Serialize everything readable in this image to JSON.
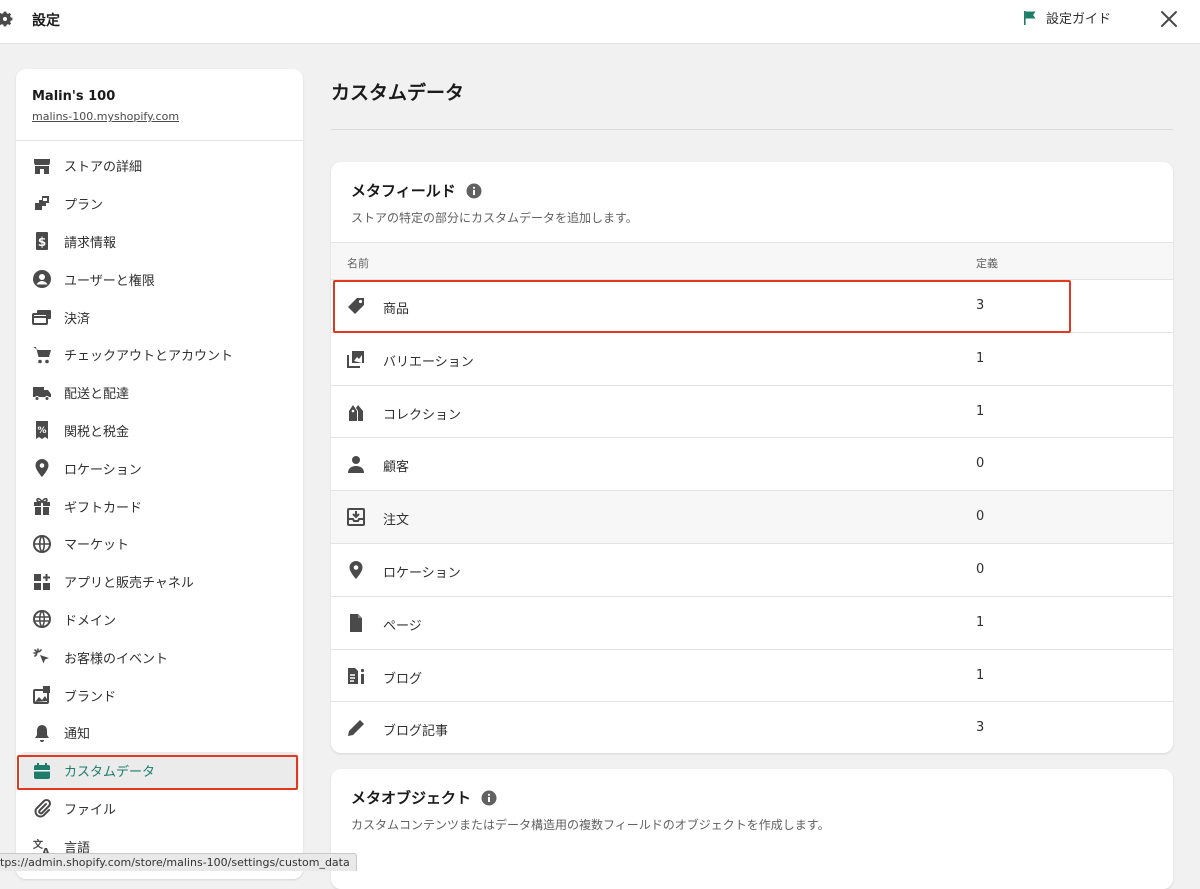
{
  "header": {
    "title": "設定",
    "guide_label": "設定ガイド",
    "guide_flag_color": "#1d7c6a"
  },
  "store": {
    "name": "Malin's 100",
    "url": "malins-100.myshopify.com"
  },
  "sidebar": {
    "items": [
      {
        "label": "ストアの詳細",
        "icon": "store-icon"
      },
      {
        "label": "プラン",
        "icon": "plan-icon"
      },
      {
        "label": "請求情報",
        "icon": "billing-icon"
      },
      {
        "label": "ユーザーと権限",
        "icon": "user-circle-icon"
      },
      {
        "label": "決済",
        "icon": "credit-card-icon"
      },
      {
        "label": "チェックアウトとアカウント",
        "icon": "cart-icon"
      },
      {
        "label": "配送と配達",
        "icon": "truck-icon"
      },
      {
        "label": "関税と税金",
        "icon": "tax-receipt-icon"
      },
      {
        "label": "ロケーション",
        "icon": "location-pin-icon"
      },
      {
        "label": "ギフトカード",
        "icon": "gift-icon"
      },
      {
        "label": "マーケット",
        "icon": "market-globe-icon"
      },
      {
        "label": "アプリと販売チャネル",
        "icon": "apps-icon"
      },
      {
        "label": "ドメイン",
        "icon": "globe-icon"
      },
      {
        "label": "お客様のイベント",
        "icon": "cursor-click-icon"
      },
      {
        "label": "ブランド",
        "icon": "brand-icon"
      },
      {
        "label": "通知",
        "icon": "bell-icon"
      },
      {
        "label": "カスタムデータ",
        "icon": "custom-data-icon"
      },
      {
        "label": "ファイル",
        "icon": "paperclip-icon"
      },
      {
        "label": "言語",
        "icon": "language-icon"
      }
    ],
    "active_index": 16,
    "active_color": "#1d7c6a"
  },
  "main": {
    "title": "カスタムデータ",
    "metafields": {
      "title": "メタフィールド",
      "description": "ストアの特定の部分にカスタムデータを追加します。",
      "col_name": "名前",
      "col_count": "定義",
      "rows": [
        {
          "label": "商品",
          "count": "3",
          "icon": "tag-icon"
        },
        {
          "label": "バリエーション",
          "count": "1",
          "icon": "variants-icon"
        },
        {
          "label": "コレクション",
          "count": "1",
          "icon": "collection-tags-icon"
        },
        {
          "label": "顧客",
          "count": "0",
          "icon": "person-icon"
        },
        {
          "label": "注文",
          "count": "0",
          "icon": "order-inbox-icon"
        },
        {
          "label": "ロケーション",
          "count": "0",
          "icon": "location-pin-icon"
        },
        {
          "label": "ページ",
          "count": "1",
          "icon": "page-icon"
        },
        {
          "label": "ブログ",
          "count": "1",
          "icon": "blog-icon"
        },
        {
          "label": "ブログ記事",
          "count": "3",
          "icon": "pencil-icon"
        }
      ]
    },
    "metaobjects": {
      "title": "メタオブジェクト",
      "description": "カスタムコンテンツまたはデータ構造用の複数フィールドのオブジェクトを作成します。"
    }
  },
  "status_url": "tps://admin.shopify.com/store/malins-100/settings/custom_data",
  "highlight_color": "#e0391f"
}
